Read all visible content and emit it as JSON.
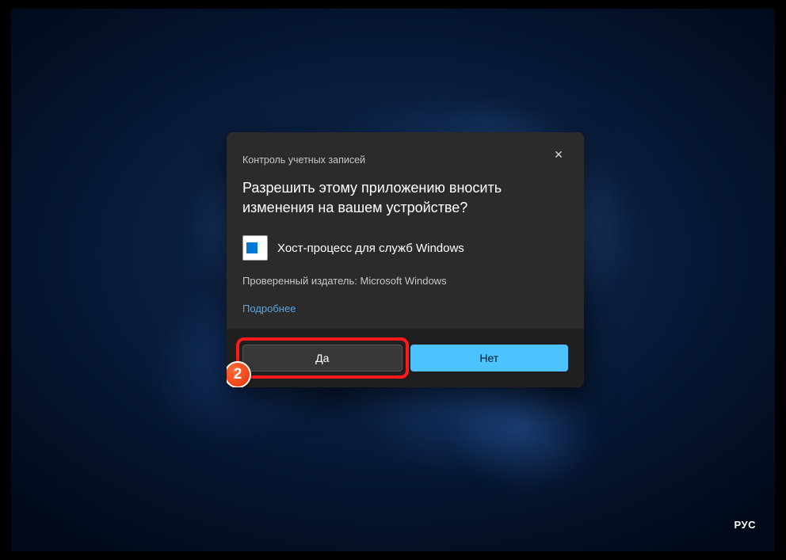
{
  "dialog": {
    "title": "Контроль учетных записей",
    "prompt": "Разрешить этому приложению вносить изменения на вашем устройстве?",
    "app_name": "Хост-процесс для служб Windows",
    "publisher": "Проверенный издатель: Microsoft Windows",
    "more_link": "Подробнее",
    "yes_label": "Да",
    "no_label": "Нет"
  },
  "annotation": {
    "step_number": "2"
  },
  "system": {
    "language_indicator": "РУС"
  }
}
